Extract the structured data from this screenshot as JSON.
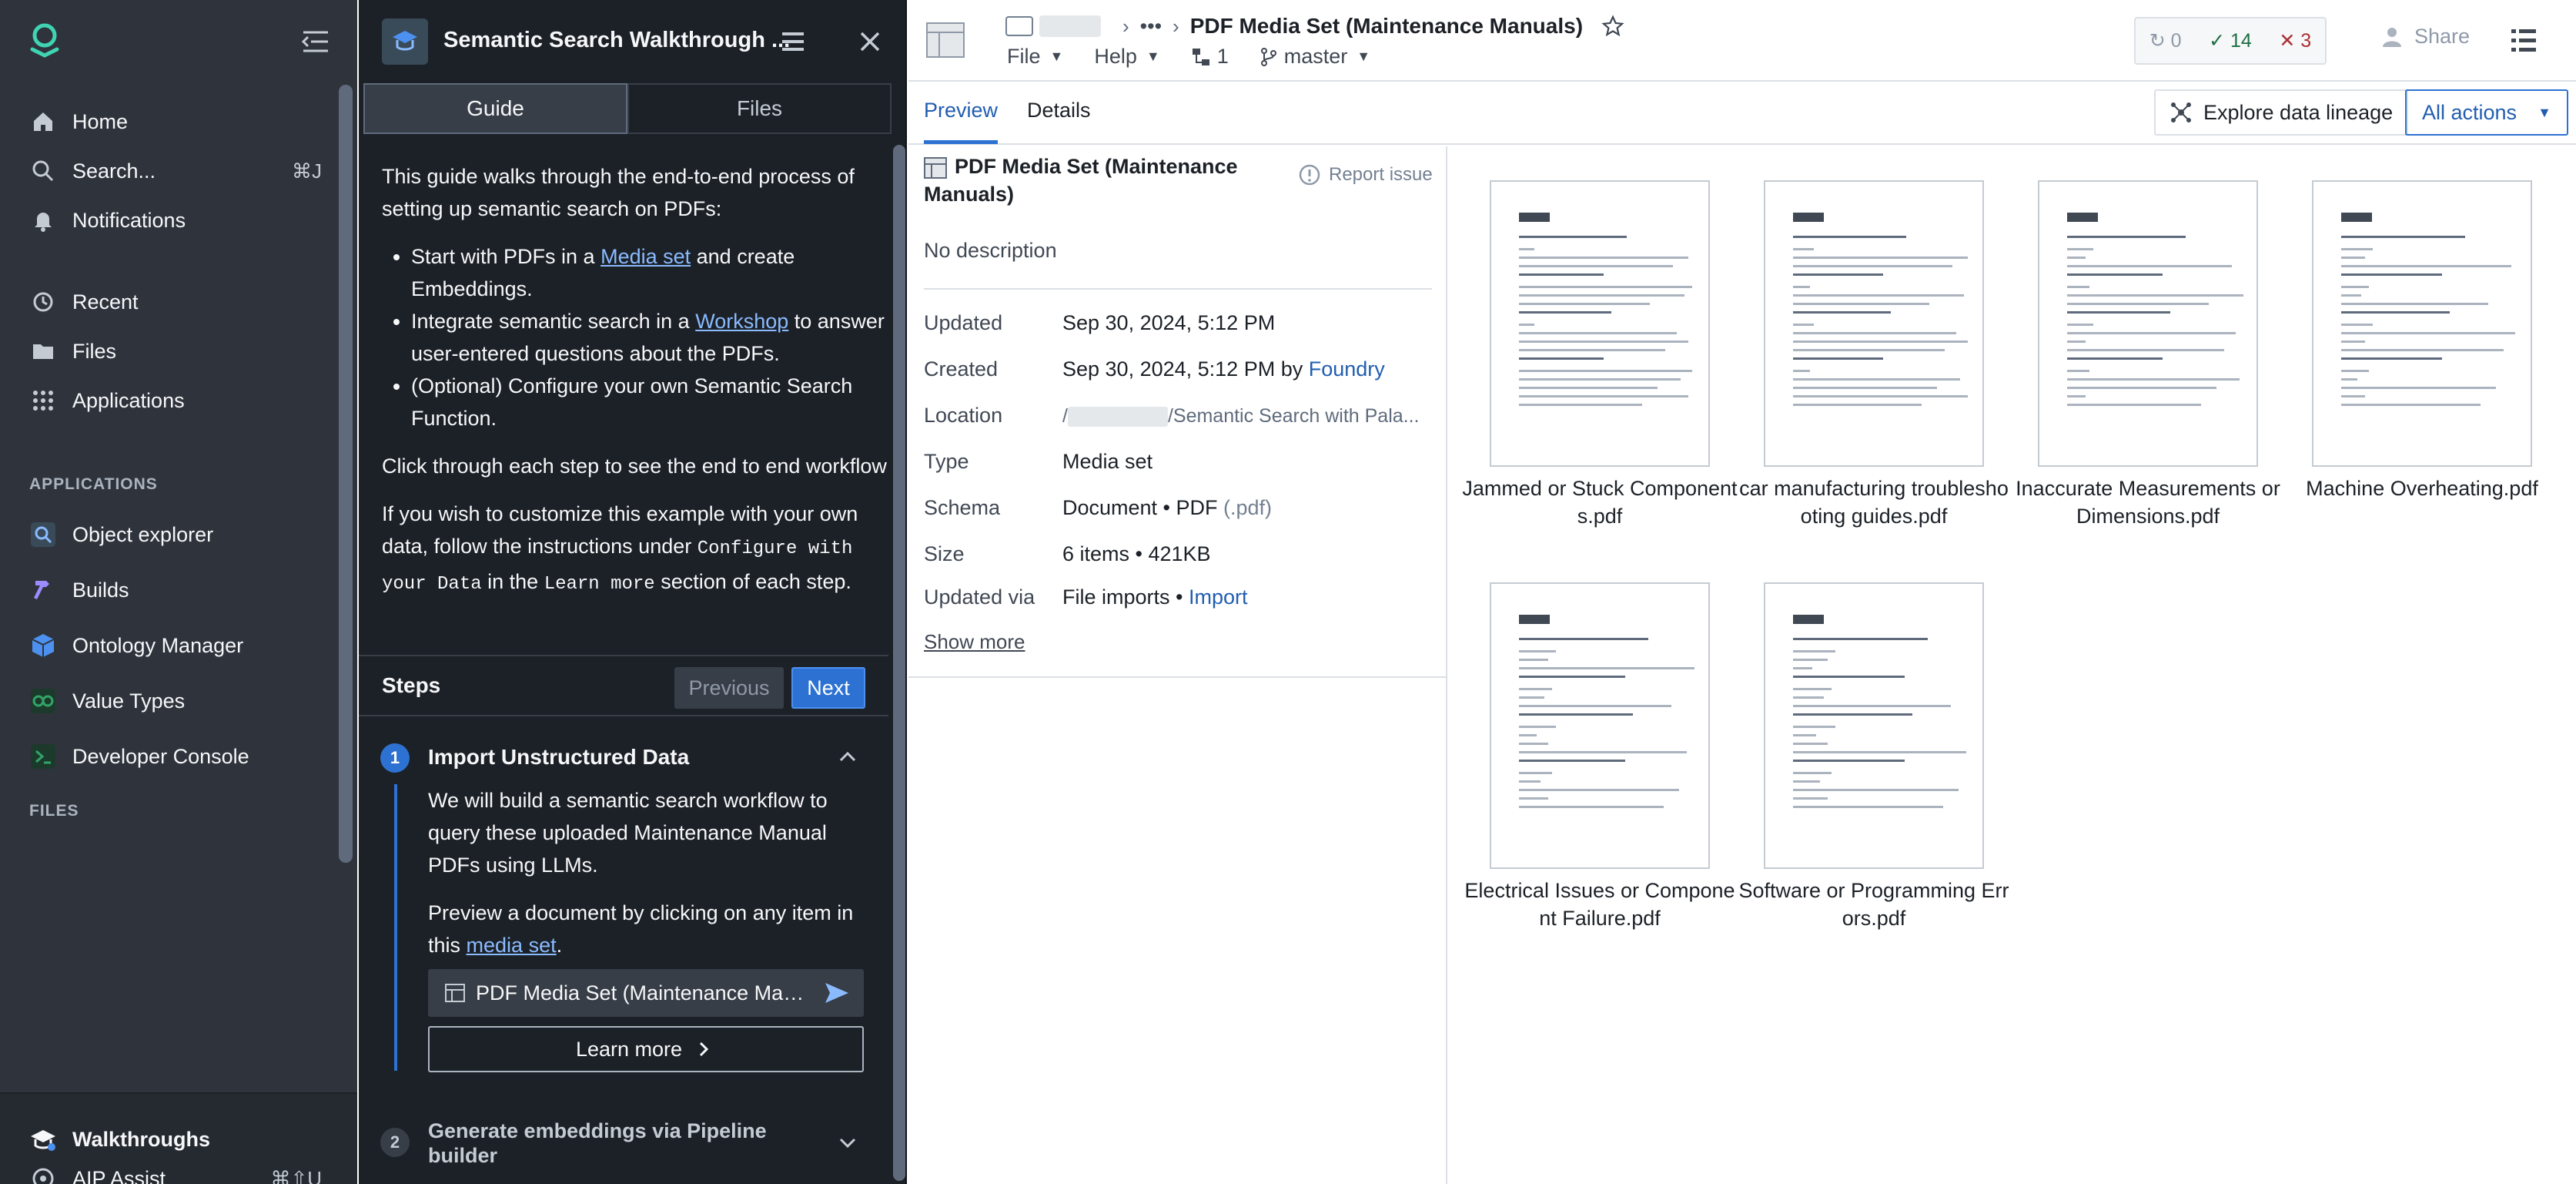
{
  "nav": {
    "items_top": [
      {
        "label": "Home",
        "icon": "home-icon"
      },
      {
        "label": "Search...",
        "icon": "search-icon",
        "shortcut": "⌘J"
      },
      {
        "label": "Notifications",
        "icon": "bell-icon"
      }
    ],
    "items_mid": [
      {
        "label": "Recent",
        "icon": "history-icon"
      },
      {
        "label": "Files",
        "icon": "folder-icon"
      },
      {
        "label": "Applications",
        "icon": "grid-icon"
      }
    ],
    "applications_heading": "APPLICATIONS",
    "applications": [
      {
        "label": "Object explorer",
        "icon": "object-explorer-icon",
        "color": "#5b8def"
      },
      {
        "label": "Builds",
        "icon": "hammer-icon",
        "color": "#7b61ff"
      },
      {
        "label": "Ontology Manager",
        "icon": "cube-icon",
        "color": "#4c90f0"
      },
      {
        "label": "Value Types",
        "icon": "link-icon",
        "color": "#32a467"
      },
      {
        "label": "Developer Console",
        "icon": "console-icon",
        "color": "#32a467"
      }
    ],
    "files_heading": "FILES",
    "bottom": [
      {
        "label": "Walkthroughs",
        "icon": "graduation-cap-icon"
      },
      {
        "label": "AIP Assist",
        "icon": "aip-icon",
        "shortcut": "⌘⇧U"
      }
    ]
  },
  "guide": {
    "title": "Semantic Search Walkthrough ...",
    "tabs": [
      "Guide",
      "Files"
    ],
    "intro": "This guide walks through the end-to-end process of setting up semantic search on PDFs:",
    "bullets": [
      {
        "before": "Start with PDFs in a ",
        "link": "Media set",
        "after": " and create Embeddings."
      },
      {
        "before": "Integrate semantic search in a ",
        "link": "Workshop",
        "after": " to answer user-entered questions about the PDFs."
      },
      {
        "before": "(Optional) Configure your own Semantic Search Function.",
        "link": "",
        "after": ""
      }
    ],
    "click_through": "Click through each step to see the end to end workflow",
    "customize_a": "If you wish to customize this example with your own data, follow the instructions under ",
    "customize_code1": "Configure with your Data",
    "customize_b": " in the ",
    "customize_code2": "Learn more",
    "customize_c": " section of each step.",
    "steps_label": "Steps",
    "prev_label": "Previous",
    "next_label": "Next",
    "step1": {
      "num": "1",
      "title": "Import Unstructured Data",
      "desc": "We will build a semantic search workflow to query these uploaded Maintenance Manual PDFs using LLMs.",
      "preview_before": "Preview a document by clicking on any item in this ",
      "preview_link": "media set",
      "preview_after": ".",
      "resource_label": "PDF Media Set (Maintenance Manuals)",
      "learn_more": "Learn more"
    },
    "step2": {
      "num": "2",
      "title": "Generate embeddings via Pipeline builder"
    }
  },
  "header": {
    "breadcrumb_ellipsis": "•••",
    "title": "PDF Media Set (Maintenance Manuals)",
    "menu_file": "File",
    "menu_help": "Help",
    "branch_count": "1",
    "branch": "master",
    "check_pending": "0",
    "check_pass": "14",
    "check_fail": "3",
    "share": "Share"
  },
  "tabs": {
    "preview": "Preview",
    "details": "Details",
    "lineage": "Explore data lineage",
    "all_actions": "All actions"
  },
  "details": {
    "title": "PDF Media Set (Maintenance Manuals)",
    "report": "Report issue",
    "description": "No description",
    "updated_label": "Updated",
    "updated": "Sep 30, 2024, 5:12 PM",
    "created_label": "Created",
    "created": "Sep 30, 2024, 5:12 PM by ",
    "created_by": "Foundry",
    "location_label": "Location",
    "location_prefix": "/",
    "location_path": "/Semantic Search with Pala...",
    "type_label": "Type",
    "type": "Media set",
    "schema_label": "Schema",
    "schema": "Document • PDF ",
    "schema_ext": "(.pdf)",
    "size_label": "Size",
    "size": "6 items  •  421KB",
    "via_label": "Updated via",
    "via": "File imports • ",
    "via_link": "Import",
    "show_more": "Show more"
  },
  "files": [
    {
      "name": "Jammed or Stuck Components.pdf"
    },
    {
      "name": "car manufacturing troubleshooting guides.pdf"
    },
    {
      "name": "Inaccurate Measurements or Dimensions.pdf"
    },
    {
      "name": "Machine Overheating.pdf"
    },
    {
      "name": "Electrical Issues or Component Failure.pdf"
    },
    {
      "name": "Software or Programming Errors.pdf"
    }
  ]
}
